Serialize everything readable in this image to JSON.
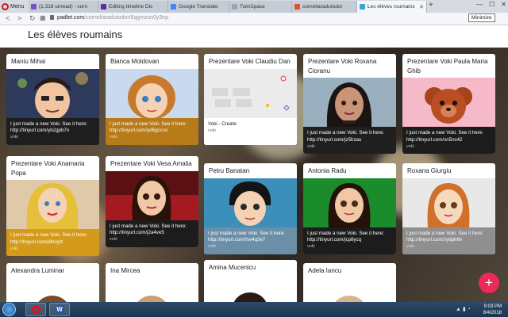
{
  "browser": {
    "menu_label": "Menu",
    "tabs": [
      {
        "label": "(1,318 unread) - corn",
        "color": "#7d4fcf"
      },
      {
        "label": "Editing timeline Dis",
        "color": "#5c2f97"
      },
      {
        "label": "Google Translate",
        "color": "#4285f4"
      },
      {
        "label": "TwinSpace",
        "color": "#9aa4ad"
      },
      {
        "label": "corneliaradutodor",
        "color": "#e44f2f"
      },
      {
        "label": "Les élèves roumains",
        "color": "#3fa0d8"
      }
    ],
    "url_host": "padlet.com",
    "url_path": "/corneliaradutodor/6qgmzsn0y3np",
    "minimize_tooltip": "Minimize"
  },
  "page": {
    "title": "Les élèves roumains"
  },
  "cards": [
    {
      "title": "Maniu Mihai",
      "text": "I just made a new Voki. See it here: http://tinyurl.com/yb2gpb7n",
      "source": "voki",
      "text_bg": "#1e1e1e",
      "img_bg": "#3f4f73"
    },
    {
      "title": "Bianca Moldovan",
      "text": "I just made a new Voki. See it here: http://tinyurl.com/yd6gccco",
      "source": "voki",
      "text_bg": "#b77b1a",
      "img_bg": "#c9d9ee"
    },
    {
      "title": "Prezentare Voki Claudiu Dan",
      "text": "Voki - Create",
      "source": "voki",
      "text_bg": "#ffffff",
      "img_bg": "#ebebeb"
    },
    {
      "title": "Prezentare Voki Roxana Cioranu",
      "text": "I just made a new Voki. See it here: http://tinyurl.com/jz5hzau",
      "source": "voki",
      "text_bg": "#1f1f1f",
      "img_bg": "#9bb0bf"
    },
    {
      "title": "Prezentare Voki Paula Maria Ghib",
      "text": "I just made a new Voki. See it here: http://tinyurl.com/sn5ns42",
      "source": "voki",
      "text_bg": "#1c1c1c",
      "img_bg": "#f6b9c9"
    },
    {
      "title": "Prezentare Voki Anamaria Popa",
      "text": "I just made a new Voki. See it here: http://tinyurl.com/j8hoylz",
      "source": "voki",
      "text_bg": "#d49a1a",
      "img_bg": "#e0c9a9"
    },
    {
      "title": "Prezentare Voki Vesa Amalia",
      "text": "I just made a new Voki. See it here: http://tinyurl.com/j2a4ve5",
      "source": "voki",
      "text_bg": "#1c1c1c",
      "img_bg": "#5c1014"
    },
    {
      "title": "Petru Banatan",
      "text": "I just made a new Voki. See it here: http://tinyurl.com/hw4q3e7",
      "source": "voki",
      "text_bg": "#6b8fa8",
      "img_bg": "#3c8fb8"
    },
    {
      "title": "Antonia Radu",
      "text": "I just made a new Voki. See it here: http://tinyurl.com/jcp8ycq",
      "source": "voki",
      "text_bg": "#1c1c1c",
      "img_bg": "#1a8c2c"
    },
    {
      "title": "Roxana Giurgiu",
      "text": "I just made a new Voki. See it here: http://tinyurl.com/zydph6n",
      "source": "voki",
      "text_bg": "#8f8f8f",
      "img_bg": "#e8e8e8"
    },
    {
      "title": "Alexandra Luminar",
      "text": "",
      "source": "",
      "text_bg": "#ffffff",
      "img_bg": "#ffffff"
    },
    {
      "title": "Ina Mircea",
      "text": "",
      "source": "",
      "text_bg": "#ffffff",
      "img_bg": "#ffffff"
    },
    {
      "title": "Amina Mucenicu",
      "text": "",
      "source": "",
      "text_bg": "#ffffff",
      "img_bg": "#ffffff"
    },
    {
      "title": "Adela Iancu",
      "text": "",
      "source": "",
      "text_bg": "#ffffff",
      "img_bg": "#ffffff"
    }
  ],
  "fab_label": "+",
  "taskbar": {
    "time": "9:03 PM",
    "date": "8/4/2018"
  }
}
